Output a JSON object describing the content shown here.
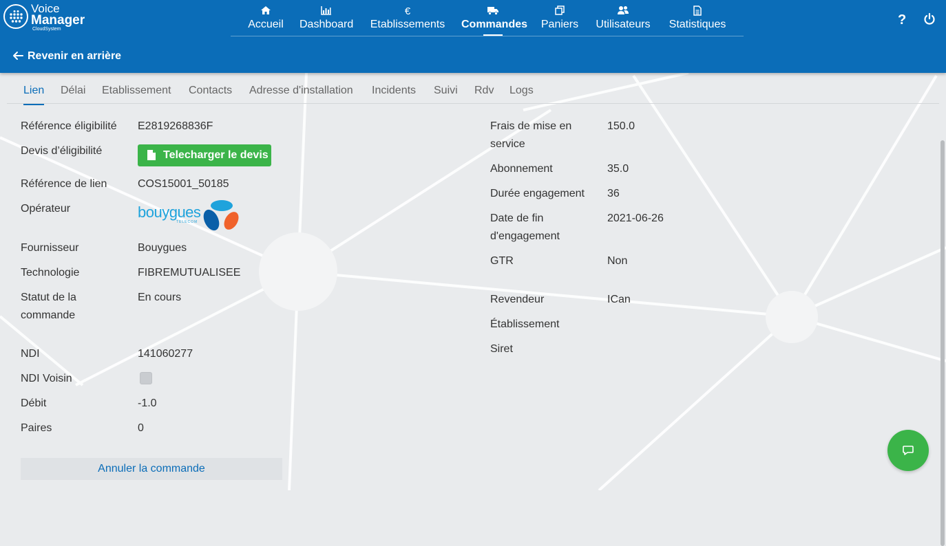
{
  "app": {
    "logo_line1": "Voice",
    "logo_line2": "Manager",
    "logo_line3": "CloudSystem",
    "accent_color": "#0b6db8"
  },
  "nav": {
    "items": [
      {
        "label": "Accueil",
        "icon": "home-icon"
      },
      {
        "label": "Dashboard",
        "icon": "chart-icon"
      },
      {
        "label": "Etablissements",
        "icon": "euro-icon",
        "glyph": "€"
      },
      {
        "label": "Commandes",
        "icon": "truck-icon",
        "active": true
      },
      {
        "label": "Paniers",
        "icon": "copy-icon"
      },
      {
        "label": "Utilisateurs",
        "icon": "users-icon"
      },
      {
        "label": "Statistiques",
        "icon": "document-icon"
      }
    ],
    "help_label": "?"
  },
  "back": {
    "label": "Revenir en arrière"
  },
  "tabs": [
    {
      "label": "Lien",
      "active": true
    },
    {
      "label": "Délai"
    },
    {
      "label": "Etablissement"
    },
    {
      "label": "Contacts"
    },
    {
      "label": "Adresse d'installation"
    },
    {
      "label": "Incidents"
    },
    {
      "label": "Suivi"
    },
    {
      "label": "Rdv"
    },
    {
      "label": "Logs"
    }
  ],
  "left": {
    "ref_elig_label": "Référence éligibilité",
    "ref_elig_value": "E2819268836F",
    "devis_label": "Devis d’éligibilité",
    "devis_button": "Telecharger le devis",
    "ref_lien_label": "Référence de lien",
    "ref_lien_value": "COS15001_50185",
    "operateur_label": "Opérateur",
    "operateur_logo_text": "bouygues",
    "operateur_logo_sub": "TELECOM",
    "fournisseur_label": "Fournisseur",
    "fournisseur_value": "Bouygues",
    "techno_label": "Technologie",
    "techno_value": "FIBREMUTUALISEE",
    "statut_label_1": "Statut de la",
    "statut_label_2": "commande",
    "statut_value": "En cours",
    "ndi_label": "NDI",
    "ndi_value": "141060277",
    "ndi_voisin_label": "NDI Voisin",
    "ndi_voisin_checked": false,
    "debit_label": "Débit",
    "debit_value": "-1.0",
    "paires_label": "Paires",
    "paires_value": "0",
    "cancel_label": "Annuler la commande"
  },
  "right": {
    "frais_label_1": "Frais de mise en",
    "frais_label_2": "service",
    "frais_value": "150.0",
    "abonnement_label": "Abonnement",
    "abonnement_value": "35.0",
    "duree_label": "Durée engagement",
    "duree_value": "36",
    "date_fin_label_1": "Date de fin",
    "date_fin_label_2": "d'engagement",
    "date_fin_value": "2021-06-26",
    "gtr_label": "GTR",
    "gtr_value": "Non",
    "revendeur_label": "Revendeur",
    "revendeur_value": "ICan",
    "etablissement_label": "Établissement",
    "siret_label": "Siret"
  },
  "colors": {
    "green": "#3bb449",
    "bouygues_blue": "#0a5fa8",
    "bouygues_orange": "#f0622b",
    "bouygues_cyan": "#1fa3dc"
  }
}
